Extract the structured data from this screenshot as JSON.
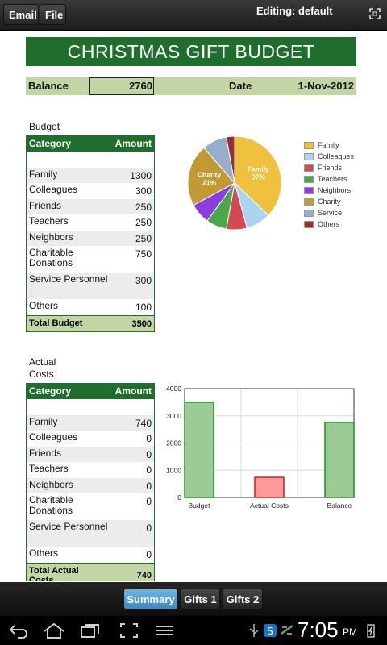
{
  "toolbar": {
    "email_label": "Email",
    "file_label": "File",
    "editing_text": "Editing: default"
  },
  "sheet": {
    "title": "CHRISTMAS GIFT BUDGET",
    "balance_label": "Balance",
    "balance_value": "2760",
    "date_label": "Date",
    "date_value": "1-Nov-2012"
  },
  "budget": {
    "section_label": "Budget",
    "col_category": "Category",
    "col_amount": "Amount",
    "rows": [
      {
        "category": "Family",
        "amount": "1300"
      },
      {
        "category": "Colleagues",
        "amount": "300"
      },
      {
        "category": "Friends",
        "amount": "250"
      },
      {
        "category": "Teachers",
        "amount": "250"
      },
      {
        "category": "Neighbors",
        "amount": "250"
      },
      {
        "category": "Charitable Donations",
        "amount": "750"
      },
      {
        "category": "Service Personnel",
        "amount": "300"
      },
      {
        "category": "Others",
        "amount": "100"
      }
    ],
    "total_label": "Total Budget",
    "total_value": "3500"
  },
  "actual": {
    "section_label": "Actual Costs",
    "col_category": "Category",
    "col_amount": "Amount",
    "rows": [
      {
        "category": "Family",
        "amount": "740"
      },
      {
        "category": "Colleagues",
        "amount": "0"
      },
      {
        "category": "Friends",
        "amount": "0"
      },
      {
        "category": "Teachers",
        "amount": "0"
      },
      {
        "category": "Neighbors",
        "amount": "0"
      },
      {
        "category": "Charitable Donations",
        "amount": "0"
      },
      {
        "category": "Service Personnel",
        "amount": "0"
      },
      {
        "category": "Others",
        "amount": "0"
      }
    ],
    "total_label": "Total Actual Costs",
    "total_value": "740"
  },
  "chart_data": [
    {
      "type": "pie",
      "categories": [
        "Family",
        "Colleagues",
        "Friends",
        "Teachers",
        "Neighbors",
        "Charity",
        "Service",
        "Others"
      ],
      "values": [
        1300,
        300,
        250,
        250,
        250,
        750,
        300,
        100
      ],
      "colors": [
        "#f0c13e",
        "#aad4f2",
        "#d04a55",
        "#4aa84a",
        "#8a3ee0",
        "#c19a33",
        "#94aecb",
        "#9a2e2a"
      ],
      "slice_labels": [
        {
          "name": "Family",
          "pct": "37%"
        },
        {
          "name": "Charity",
          "pct": "21%"
        }
      ],
      "legend_position": "right"
    },
    {
      "type": "bar",
      "categories": [
        "Budget",
        "Actual Costs",
        "Balance"
      ],
      "values": [
        3500,
        740,
        2760
      ],
      "colors": [
        "#9ccc96",
        "#ff9a9a",
        "#9ccc96"
      ],
      "border_colors": [
        "#1e8a2a",
        "#d41a1a",
        "#1e8a2a"
      ],
      "ylim": [
        0,
        4000
      ],
      "yticks": [
        "0",
        "1000",
        "2000",
        "3000",
        "4000"
      ],
      "grid": true
    }
  ],
  "tabs": [
    {
      "label": "Summary",
      "active": true
    },
    {
      "label": "Gifts 1",
      "active": false
    },
    {
      "label": "Gifts 2",
      "active": false
    }
  ],
  "system": {
    "time": "7:05",
    "ampm": "PM"
  }
}
